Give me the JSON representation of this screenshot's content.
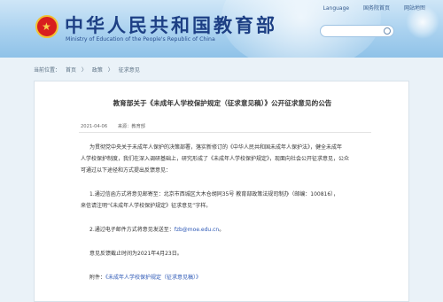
{
  "header": {
    "title": "中华人民共和国教育部",
    "subtitle": "Ministry of Education of the People's Republic of China",
    "links": [
      "Language",
      "国务院首页",
      "网站地图"
    ],
    "search_placeholder": ""
  },
  "breadcrumb": {
    "prefix": "当前位置：",
    "items": [
      "首页",
      "〉",
      "政策",
      "〉",
      "征求意见"
    ]
  },
  "article": {
    "title": "教育部关于《未成年人学校保护规定（征求意见稿）》公开征求意见的公告",
    "date": "2021-04-06",
    "source": "来源：教育部",
    "p1_line1": "为贯彻党中央关于未成年人保护的决策部署，落实新修订的《中华人民共和国未成年人保护法》，健全未成年",
    "p1_line2": "人学校保护制度，我们在深入调研基础上，研究形成了《未成年人学校保护规定》，现面向社会公开征求意见，公众",
    "p1_line3": "可通过以下途径和方式提出反馈意见：",
    "item1_line1": "1.通过信函方式将意见邮寄至：北京市西城区大木仓胡同35号 教育部政策法规司制办（邮编：100816），",
    "item1_line2": "来信请注明“《未成年人学校保护规定》征求意见”字样。",
    "item2_label": "2.通过电子邮件方式将意见发送至：",
    "item2_email": "fzb@moe.edu.cn",
    "item2_end": "。",
    "deadline": "意见反馈截止时间为2021年4月23日。",
    "attachment_label": "附件：",
    "attachment_link": "《未成年人学校保护规定（征求意见稿）》"
  },
  "colors": {
    "title_blue": "#1d3f84",
    "link_blue": "#2a56b5",
    "emblem_red": "#d81e1e"
  }
}
